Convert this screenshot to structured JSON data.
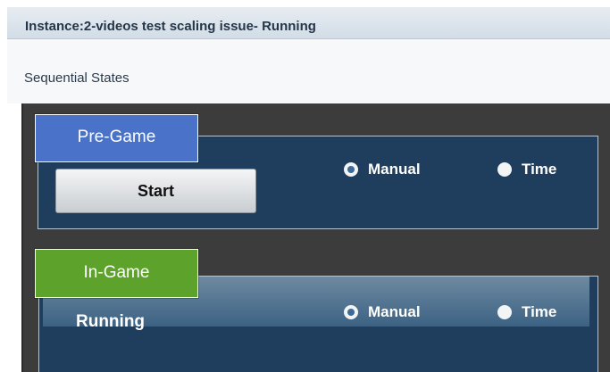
{
  "window": {
    "title": "Instance:2-videos test scaling issue- Running"
  },
  "section": {
    "title": "Sequential States"
  },
  "states": [
    {
      "tag": "Pre-Game",
      "tag_color": "#4a72c9",
      "action_label": "Start",
      "options": [
        {
          "label": "Manual",
          "selected": true
        },
        {
          "label": "Time",
          "selected": false
        }
      ]
    },
    {
      "tag": "In-Game",
      "tag_color": "#5da32b",
      "status_text": "Running",
      "options": [
        {
          "label": "Manual",
          "selected": true
        },
        {
          "label": "Time",
          "selected": false
        }
      ]
    }
  ]
}
